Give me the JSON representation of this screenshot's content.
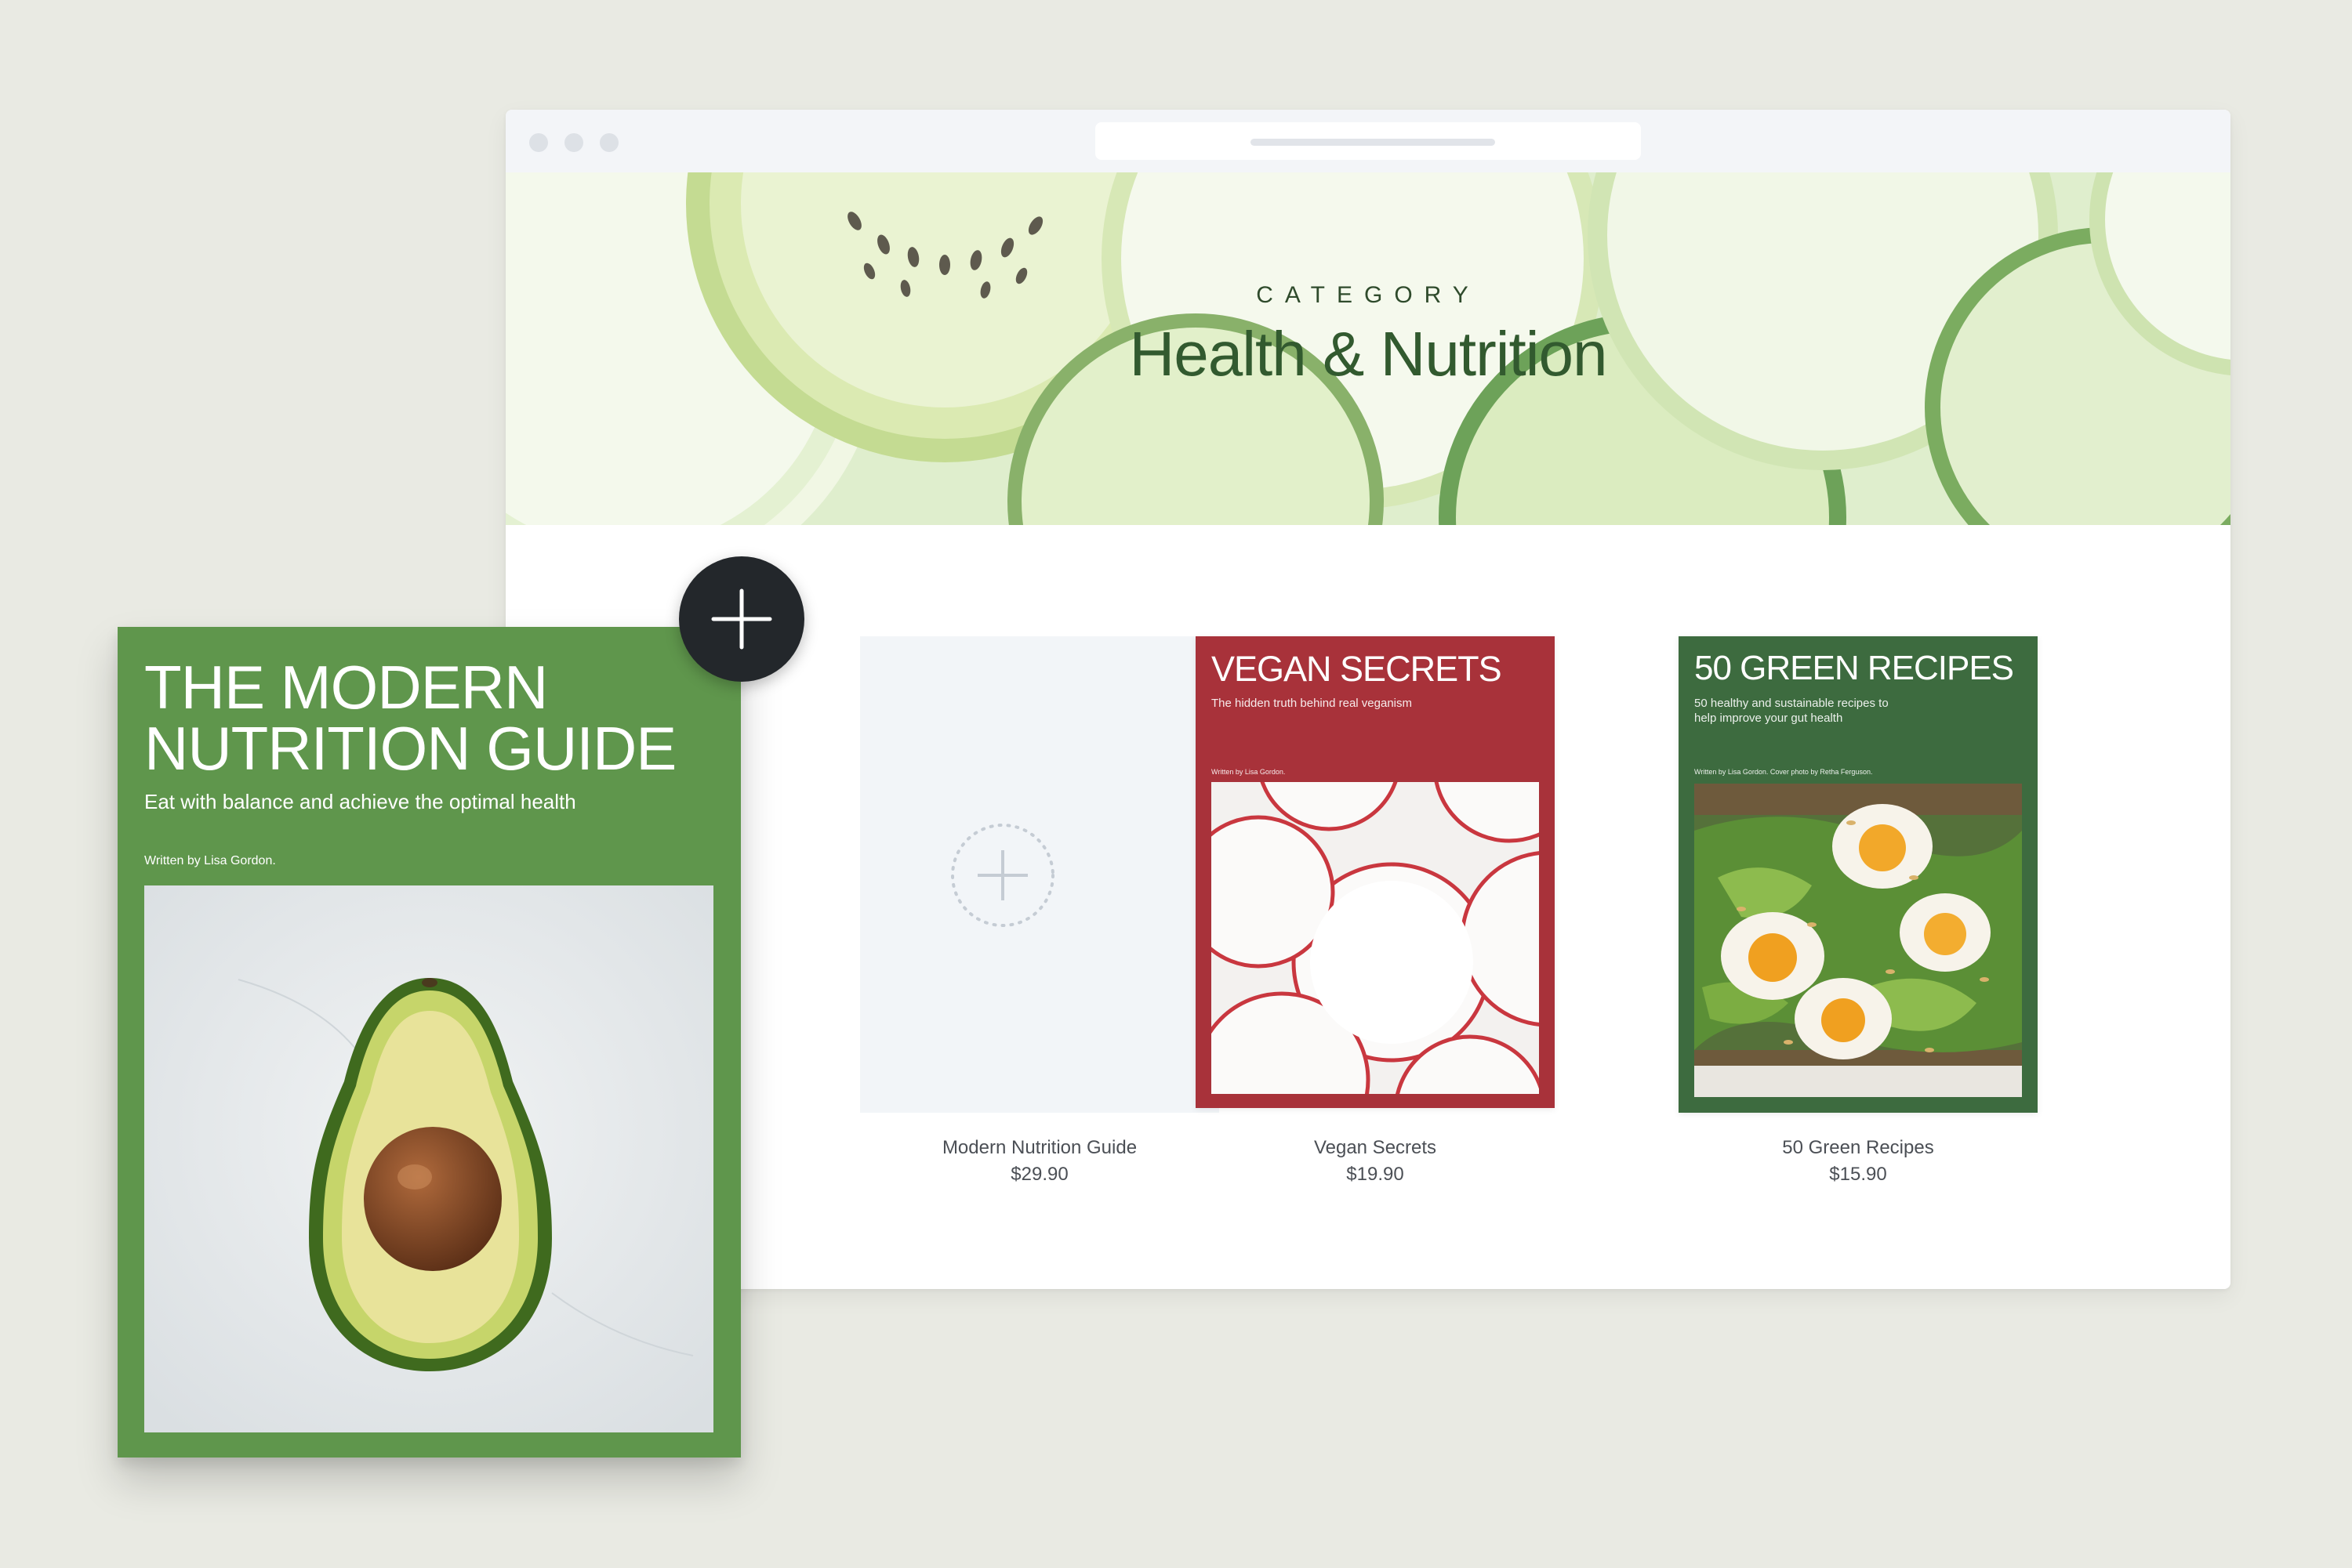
{
  "hero": {
    "eyebrow": "CATEGORY",
    "title": "Health & Nutrition"
  },
  "products": [
    {
      "name": "Modern Nutrition Guide",
      "price": "$29.90"
    },
    {
      "name": "Vegan Secrets",
      "price": "$19.90"
    },
    {
      "name": "50 Green Recipes",
      "price": "$15.90"
    }
  ],
  "covers": {
    "vegan": {
      "title": "VEGAN SECRETS",
      "subtitle": "The hidden truth behind real veganism",
      "author": "Written by Lisa Gordon."
    },
    "green": {
      "title": "50 GREEN RECIPES",
      "subtitle_line1": "50 healthy and sustainable recipes to",
      "subtitle_line2": "help improve your gut health",
      "author": "Written by Lisa Gordon. Cover photo by Retha Ferguson."
    },
    "modern": {
      "title_line1": "THE MODERN",
      "title_line2": "NUTRITION GUIDE",
      "subtitle": "Eat with balance and achieve the optimal health",
      "author": "Written by Lisa Gordon."
    }
  },
  "colors": {
    "background": "#e9eae3",
    "hero_title": "#325a2f",
    "vegan_cover": "#a8323a",
    "green_cover": "#3d6b3f",
    "modern_cover": "#5f964c",
    "add_button": "#23272b"
  },
  "icons": {
    "add_button": "plus-icon",
    "placeholder": "dashed-plus-icon"
  }
}
